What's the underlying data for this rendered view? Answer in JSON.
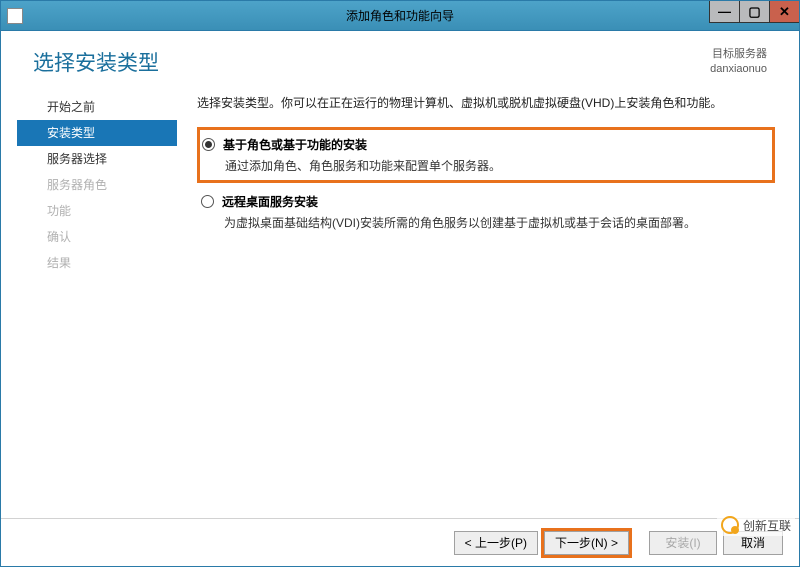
{
  "window": {
    "title": "添加角色和功能向导"
  },
  "header": {
    "page_title": "选择安装类型",
    "target_label": "目标服务器",
    "target_name": "danxiaonuo"
  },
  "sidebar": {
    "items": [
      {
        "label": "开始之前",
        "state": "normal"
      },
      {
        "label": "安装类型",
        "state": "active"
      },
      {
        "label": "服务器选择",
        "state": "normal"
      },
      {
        "label": "服务器角色",
        "state": "disabled"
      },
      {
        "label": "功能",
        "state": "disabled"
      },
      {
        "label": "确认",
        "state": "disabled"
      },
      {
        "label": "结果",
        "state": "disabled"
      }
    ]
  },
  "main": {
    "intro": "选择安装类型。你可以在正在运行的物理计算机、虚拟机或脱机虚拟硬盘(VHD)上安装角色和功能。",
    "options": [
      {
        "label": "基于角色或基于功能的安装",
        "desc": "通过添加角色、角色服务和功能来配置单个服务器。",
        "selected": true,
        "highlight": true
      },
      {
        "label": "远程桌面服务安装",
        "desc": "为虚拟桌面基础结构(VDI)安装所需的角色服务以创建基于虚拟机或基于会话的桌面部署。",
        "selected": false,
        "highlight": false
      }
    ]
  },
  "footer": {
    "prev": "< 上一步(P)",
    "next": "下一步(N) >",
    "install": "安装(I)",
    "cancel": "取消"
  },
  "watermark": {
    "text": "创新互联"
  }
}
